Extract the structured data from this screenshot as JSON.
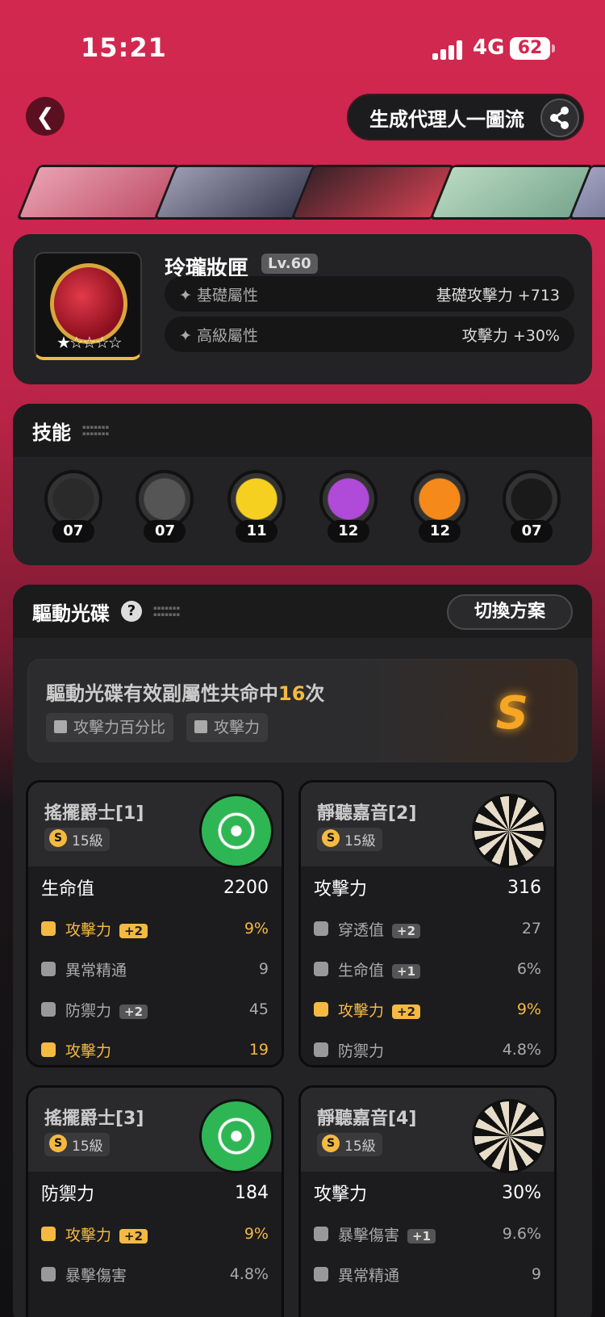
{
  "status": {
    "time": "15:21",
    "network": "4G",
    "battery": "62"
  },
  "header": {
    "generate_label": "生成代理人一圖流"
  },
  "equipment": {
    "name": "玲瓏妝匣",
    "level": "Lv.60",
    "stats": [
      {
        "label": "基礎屬性",
        "value": "基礎攻擊力 +713"
      },
      {
        "label": "高級屬性",
        "value": "攻擊力 +30%"
      }
    ]
  },
  "skills": {
    "title": "技能",
    "items": [
      {
        "level": "07",
        "color": "#2a2a2a"
      },
      {
        "level": "07",
        "color": "#555555"
      },
      {
        "level": "11",
        "color": "#f5d020"
      },
      {
        "level": "12",
        "color": "#b04ad8"
      },
      {
        "level": "12",
        "color": "#f58a1a"
      },
      {
        "level": "07",
        "color": "#1a1a1a"
      }
    ]
  },
  "drive": {
    "title": "驅動光碟",
    "switch_label": "切換方案",
    "summary_prefix": "驅動光碟有效副屬性共命中",
    "summary_count": "16",
    "summary_suffix": "次",
    "tags": [
      "攻擊力百分比",
      "攻擊力"
    ],
    "rank": "S",
    "discs": [
      {
        "name": "搖擺爵士[1]",
        "level": "15級",
        "art": "green",
        "main": {
          "label": "生命值",
          "value": "2200"
        },
        "subs": [
          {
            "label": "攻擊力",
            "up": "+2",
            "value": "9%",
            "hl": true
          },
          {
            "label": "異常精通",
            "up": "",
            "value": "9",
            "hl": false
          },
          {
            "label": "防禦力",
            "up": "+2",
            "value": "45",
            "hl": false
          },
          {
            "label": "攻擊力",
            "up": "",
            "value": "19",
            "hl": true
          }
        ]
      },
      {
        "name": "靜聽嘉音[2]",
        "level": "15級",
        "art": "white",
        "main": {
          "label": "攻擊力",
          "value": "316"
        },
        "subs": [
          {
            "label": "穿透值",
            "up": "+2",
            "value": "27",
            "hl": false
          },
          {
            "label": "生命值",
            "up": "+1",
            "value": "6%",
            "hl": false
          },
          {
            "label": "攻擊力",
            "up": "+2",
            "value": "9%",
            "hl": true
          },
          {
            "label": "防禦力",
            "up": "",
            "value": "4.8%",
            "hl": false
          }
        ]
      },
      {
        "name": "搖擺爵士[3]",
        "level": "15級",
        "art": "green",
        "main": {
          "label": "防禦力",
          "value": "184"
        },
        "subs": [
          {
            "label": "攻擊力",
            "up": "+2",
            "value": "9%",
            "hl": true
          },
          {
            "label": "暴擊傷害",
            "up": "",
            "value": "4.8%",
            "hl": false
          }
        ]
      },
      {
        "name": "靜聽嘉音[4]",
        "level": "15級",
        "art": "white",
        "main": {
          "label": "攻擊力",
          "value": "30%"
        },
        "subs": [
          {
            "label": "暴擊傷害",
            "up": "+1",
            "value": "9.6%",
            "hl": false
          },
          {
            "label": "異常精通",
            "up": "",
            "value": "9",
            "hl": false
          }
        ]
      }
    ]
  }
}
